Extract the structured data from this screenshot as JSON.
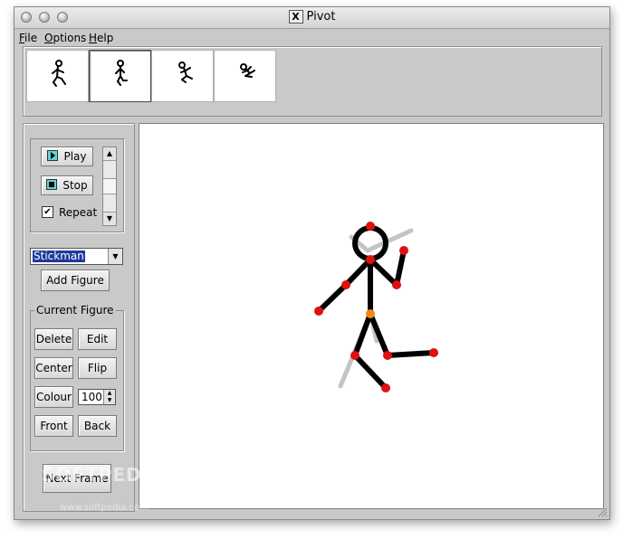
{
  "window": {
    "title": "Pivot"
  },
  "menu": {
    "file": "File",
    "options": "Options",
    "help": "Help"
  },
  "frames": {
    "selected_index": 1,
    "count": 4
  },
  "playback": {
    "play_label": "Play",
    "stop_label": "Stop",
    "repeat_label": "Repeat",
    "repeat_checked": true
  },
  "figure_select": {
    "value": "Stickman"
  },
  "add_figure_label": "Add Figure",
  "current_figure": {
    "legend": "Current Figure",
    "delete_label": "Delete",
    "edit_label": "Edit",
    "center_label": "Center",
    "flip_label": "Flip",
    "colour_label": "Colour",
    "colour_value": "100",
    "front_label": "Front",
    "back_label": "Back"
  },
  "next_frame_label": "Next Frame",
  "watermark": {
    "text": "SOFTPEDIA",
    "sub": "www.softpedia.com"
  },
  "colors": {
    "handle_red": "#e01010",
    "handle_orange": "#f08a10",
    "figure": "#000000",
    "shadow": "#c4c4c4",
    "icon_accent": "#5fd4d4"
  }
}
